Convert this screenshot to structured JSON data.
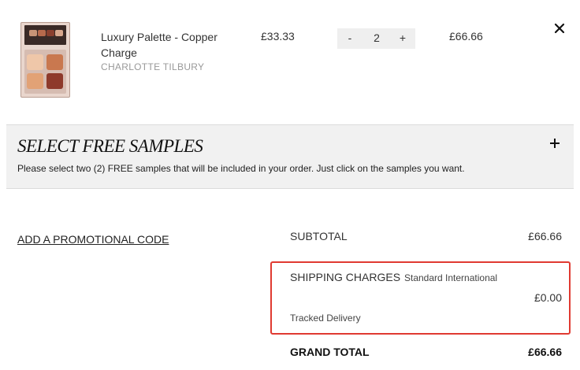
{
  "cart_item": {
    "name": "Luxury Palette - Copper Charge",
    "brand": "CHARLOTTE TILBURY",
    "unit_price": "£33.33",
    "quantity": "2",
    "minus_symbol": "-",
    "plus_symbol": "+",
    "line_total": "£66.66",
    "thumbnail_icon": "eyeshadow-palette-image",
    "remove_icon": "close-icon"
  },
  "free_samples": {
    "title": "SELECT FREE SAMPLES",
    "description": "Please select two (2) FREE samples that will be included in your order. Just click on the samples you want.",
    "toggle_icon": "plus-icon"
  },
  "summary": {
    "promo_link": "ADD A PROMOTIONAL CODE",
    "subtotal_label": "SUBTOTAL",
    "subtotal_value": "£66.66",
    "shipping_label": "SHIPPING CHARGES",
    "shipping_method": "Standard International",
    "shipping_value": "£0.00",
    "shipping_note": "Tracked Delivery",
    "grand_total_label": "GRAND TOTAL",
    "grand_total_value": "£66.66"
  },
  "colors": {
    "highlight_border": "#e03a31",
    "panel_background": "#f1f1f1",
    "stepper_background": "#efefef",
    "brand_text": "#999999"
  }
}
